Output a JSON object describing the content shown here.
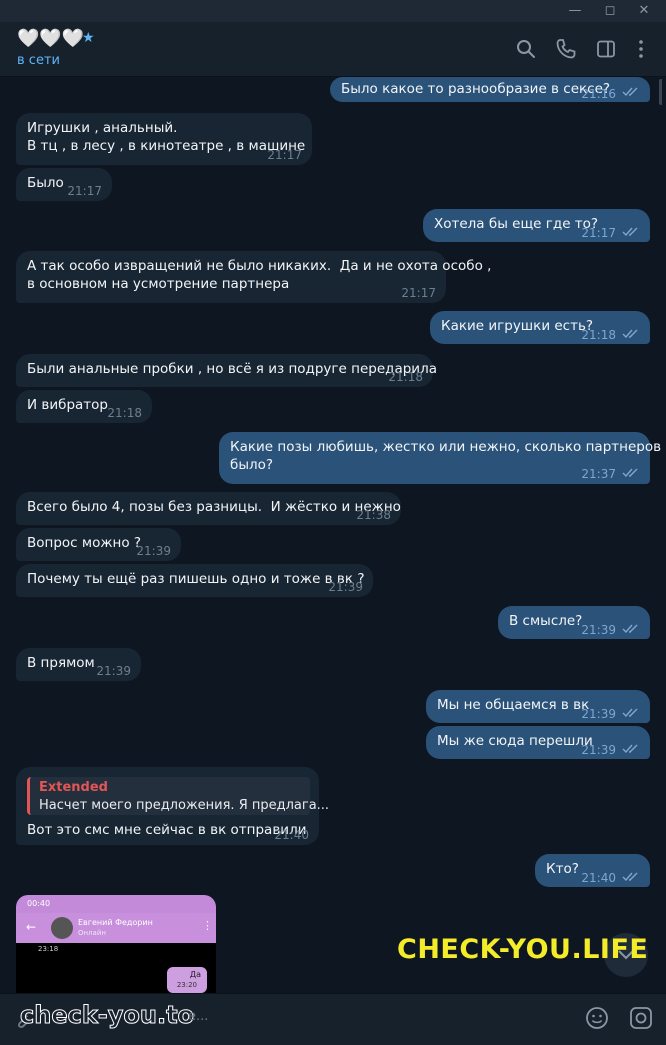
{
  "header": {
    "title": "🤍🤍🤍",
    "status": "в сети"
  },
  "messages": [
    {
      "text": "Было какое то разнообразие в сексе?",
      "time": "21:16"
    },
    {
      "text": "Игрушки , анальный.\nВ тц , в лесу , в кинотеатре , в машине",
      "time": "21:17"
    },
    {
      "text": "Было",
      "time": "21:17"
    },
    {
      "text": "Хотела бы еще где то?",
      "time": "21:17"
    },
    {
      "text": "А так особо извращений не было никаких.  Да и не охота особо ,\nв основном на усмотрение партнера",
      "time": "21:17"
    },
    {
      "text": "Какие игрушки есть?",
      "time": "21:18"
    },
    {
      "text": "Были анальные пробки , но всё я из подруге передарила",
      "time": "21:18"
    },
    {
      "text": "И вибратор",
      "time": "21:18"
    },
    {
      "text": "Какие позы любишь, жестко или нежно, сколько партнеров\nбыло?",
      "time": "21:37"
    },
    {
      "text": "Всего было 4, позы без разницы.  И жёстко и нежно",
      "time": "21:38"
    },
    {
      "text": "Вопрос можно ?",
      "time": "21:39"
    },
    {
      "text": "Почему ты ещё раз пишешь одно и тоже в вк ?",
      "time": "21:39"
    },
    {
      "text": "В смысле?",
      "time": "21:39"
    },
    {
      "text": "В прямом",
      "time": "21:39"
    },
    {
      "text": "Мы не общаемся в вк",
      "time": "21:39"
    },
    {
      "text": "Мы же сюда перешли",
      "time": "21:39"
    },
    {
      "text": "Вот это смс мне сейчас в вк отправили",
      "time": "21:40",
      "reply_name": "Extended",
      "reply_text": "Насчет моего предложения. Я предлага..."
    },
    {
      "text": "Кто?",
      "time": "21:40"
    }
  ],
  "photo": {
    "status_time": "00:40",
    "contact_name": "Евгений Федорин",
    "contact_status": "Онлайн",
    "left_time": "23:18",
    "bubble_text": "Да",
    "bubble_time": "23:20"
  },
  "watermark": "CHECK-YOU.LIFE",
  "composer": {
    "watermark": "check-you.to",
    "placeholder_tail": "e..."
  },
  "colors": {
    "background": "#0e1621",
    "incoming": "#182533",
    "outgoing": "#2b5278",
    "accent": "#5eb5f7",
    "watermark": "#f5ec29"
  },
  "icons": [
    "minimize-icon",
    "maximize-icon",
    "close-icon",
    "search-icon",
    "phone-icon",
    "sidebar-icon",
    "more-icon",
    "double-check-icon",
    "attach-icon",
    "emoji-icon",
    "camera-icon",
    "arrow-down-icon"
  ]
}
